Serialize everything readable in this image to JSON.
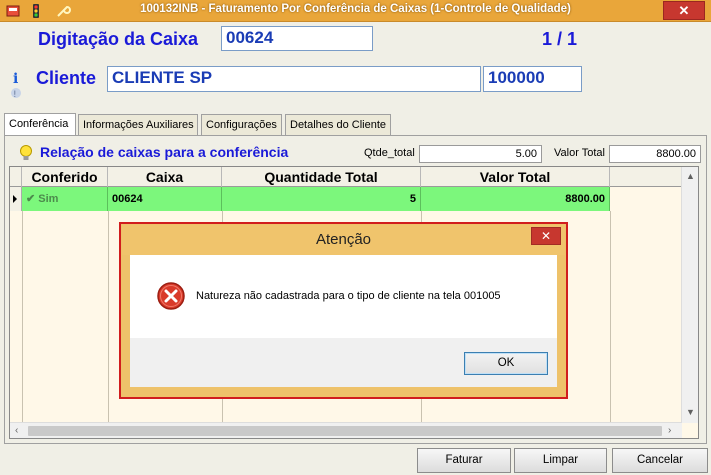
{
  "window": {
    "title": "100132INB - Faturamento Por Conferência de Caixas (1-Controle de Qualidade)",
    "close_label": "✕"
  },
  "header": {
    "digitacao_label": "Digitação da Caixa",
    "caixa_value": "00624",
    "counter": "1 / 1",
    "cliente_label": "Cliente",
    "cliente_name": "CLIENTE SP",
    "cliente_code": "100000"
  },
  "tabs": [
    {
      "label": "Conferência",
      "active": true
    },
    {
      "label": "Informações Auxiliares",
      "active": false
    },
    {
      "label": "Configurações",
      "active": false
    },
    {
      "label": "Detalhes do Cliente",
      "active": false
    }
  ],
  "panel": {
    "subhead": "Relação de caixas para a conferência",
    "qtde_label": "Qtde_total",
    "qtde_value": "5.00",
    "valor_label": "Valor Total",
    "valor_value": "8800.00"
  },
  "grid": {
    "columns": [
      "Conferido",
      "Caixa",
      "Quantidade Total",
      "Valor Total"
    ],
    "rows": [
      {
        "conferido": "Sim",
        "caixa": "00624",
        "quantidade": "5",
        "valor": "8800.00"
      }
    ]
  },
  "buttons": {
    "faturar": "Faturar",
    "limpar": "Limpar",
    "cancelar": "Cancelar"
  },
  "dialog": {
    "title": "Atenção",
    "message": "Natureza não cadastrada para o tipo de cliente na tela 001005",
    "ok": "OK",
    "close": "✕"
  },
  "colors": {
    "accent_blue": "#1a1ad8",
    "title_orange": "#e9a63a",
    "row_green": "#7cf77c",
    "error_red": "#d11d1d"
  }
}
